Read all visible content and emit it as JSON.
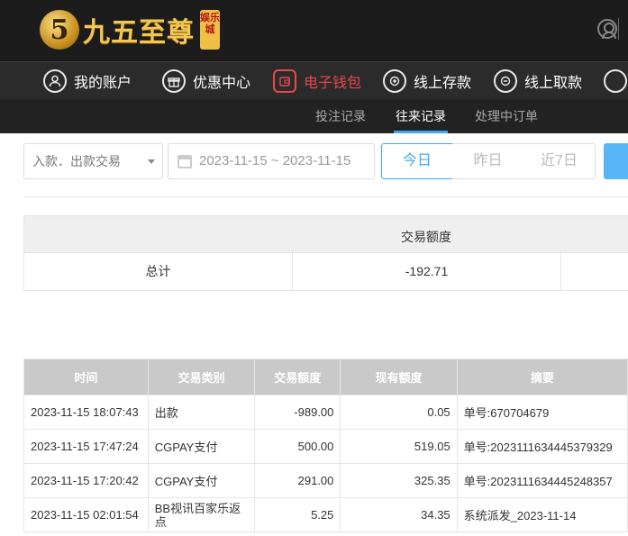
{
  "brand": {
    "logo_mark": "5",
    "name": "九五至尊",
    "badge": "娱乐城"
  },
  "nav": [
    {
      "label": "我的账户",
      "icon": "user-icon"
    },
    {
      "label": "优惠中心",
      "icon": "gift-icon"
    },
    {
      "label": "电子钱包",
      "icon": "wallet-icon",
      "active": true
    },
    {
      "label": "线上存款",
      "icon": "deposit-icon"
    },
    {
      "label": "线上取款",
      "icon": "withdraw-icon"
    }
  ],
  "subnav": [
    {
      "label": "投注记录"
    },
    {
      "label": "往来记录",
      "active": true
    },
    {
      "label": "处理中订单"
    }
  ],
  "filters": {
    "type_select": "入款．出款交易",
    "date_range": "2023-11-15 ~ 2023-11-15",
    "quick": [
      "今日",
      "昨日",
      "近7日"
    ]
  },
  "summary": {
    "header": "交易额度",
    "row_label": "总计",
    "row_value": "-192.71"
  },
  "records": {
    "columns": [
      "时间",
      "交易类别",
      "交易额度",
      "现有额度",
      "摘要"
    ],
    "rows": [
      [
        "2023-11-15 18:07:43",
        "出款",
        "-989.00",
        "0.05",
        "单号:670704679"
      ],
      [
        "2023-11-15 17:47:24",
        "CGPAY支付",
        "500.00",
        "519.05",
        "单号:2023111634445379329"
      ],
      [
        "2023-11-15 17:20:42",
        "CGPAY支付",
        "291.00",
        "325.35",
        "单号:2023111634445248357"
      ],
      [
        "2023-11-15 02:01:54",
        "BB视讯百家乐返点",
        "5.25",
        "34.35",
        "系统派发_2023-11-14"
      ]
    ]
  },
  "colors": {
    "accent": "#3fa9f5",
    "nav_active": "#e8474c",
    "header_bg": "#1c1c1c"
  }
}
